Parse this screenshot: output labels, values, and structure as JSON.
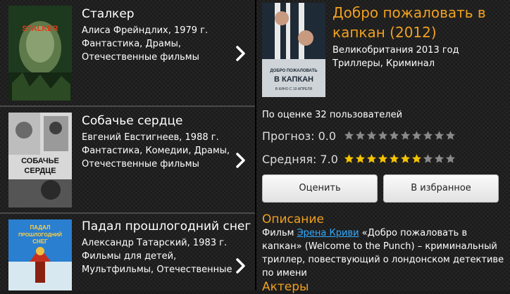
{
  "movies": [
    {
      "title": "Сталкер",
      "line1": "Алиса Фрейндлих, 1979 г.",
      "line2": "Фантастика, Драмы,",
      "line3": "Отечественные фильмы",
      "poster_text": "STALKER"
    },
    {
      "title": "Собачье сердце",
      "line1": "Евгений Евстигнеев, 1988 г.",
      "line2": "Фантастика, Комедии, Драмы,",
      "line3": "Отечественные фильмы",
      "poster_text": "СОБАЧЬЕ СЕРДЦЕ"
    },
    {
      "title": "Падал прошлогодний снег",
      "line1": "Александр Татарский, 1983 г.",
      "line2": "Фильмы для детей,",
      "line3": "Мультфильмы, Отечественные",
      "poster_text": "ПАДАЛ ПРОШЛОГОДНИЙ СНЕГ"
    }
  ],
  "detail": {
    "title": "Добро пожаловать в капкан (2012)",
    "country_year": "Великобритания 2013 год",
    "genres": "Триллеры, Криминал",
    "poster_text": "ДОБРО ПОЖАЛОВАТЬ В КАПКАН",
    "poster_date": "В КИНО С 19 АПРЕЛЯ",
    "votes": "По оценке 32 пользователей",
    "forecast_label": "Прогноз: 0.0",
    "forecast_value": 0,
    "average_label": "Средняя: 7.0",
    "average_value": 7,
    "stars_total": 10,
    "rate_button": "Оценить",
    "favorite_button": "В избранное",
    "description_heading": "Описание",
    "desc_prefix": "Фильм ",
    "desc_link": "Эрена Криви",
    "desc_rest": " «Добро пожаловать в капкан» (Welcome to the Punch) – криминальный триллер, повествующий о лондонском детективе по имени",
    "actors_heading": "Актеры"
  },
  "colors": {
    "accent": "#f0a020",
    "link": "#33aaff",
    "star_on": "#f5c400",
    "star_off": "#8a8a8a"
  }
}
